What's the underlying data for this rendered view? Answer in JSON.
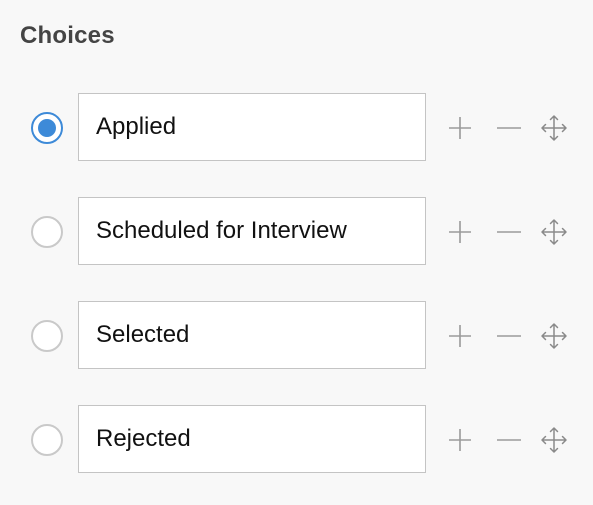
{
  "heading": "Choices",
  "selected_index": 0,
  "choices": [
    {
      "label": "Applied",
      "selected": true
    },
    {
      "label": "Scheduled for Interview",
      "selected": false
    },
    {
      "label": "Selected",
      "selected": false
    },
    {
      "label": "Rejected",
      "selected": false
    }
  ],
  "icons": {
    "add": "plus-icon",
    "remove": "minus-icon",
    "move": "move-arrows-icon"
  },
  "colors": {
    "accent": "#3d8ad8",
    "heading": "#444444",
    "icon": "#9a9a9a",
    "border": "#c4c4c4"
  }
}
